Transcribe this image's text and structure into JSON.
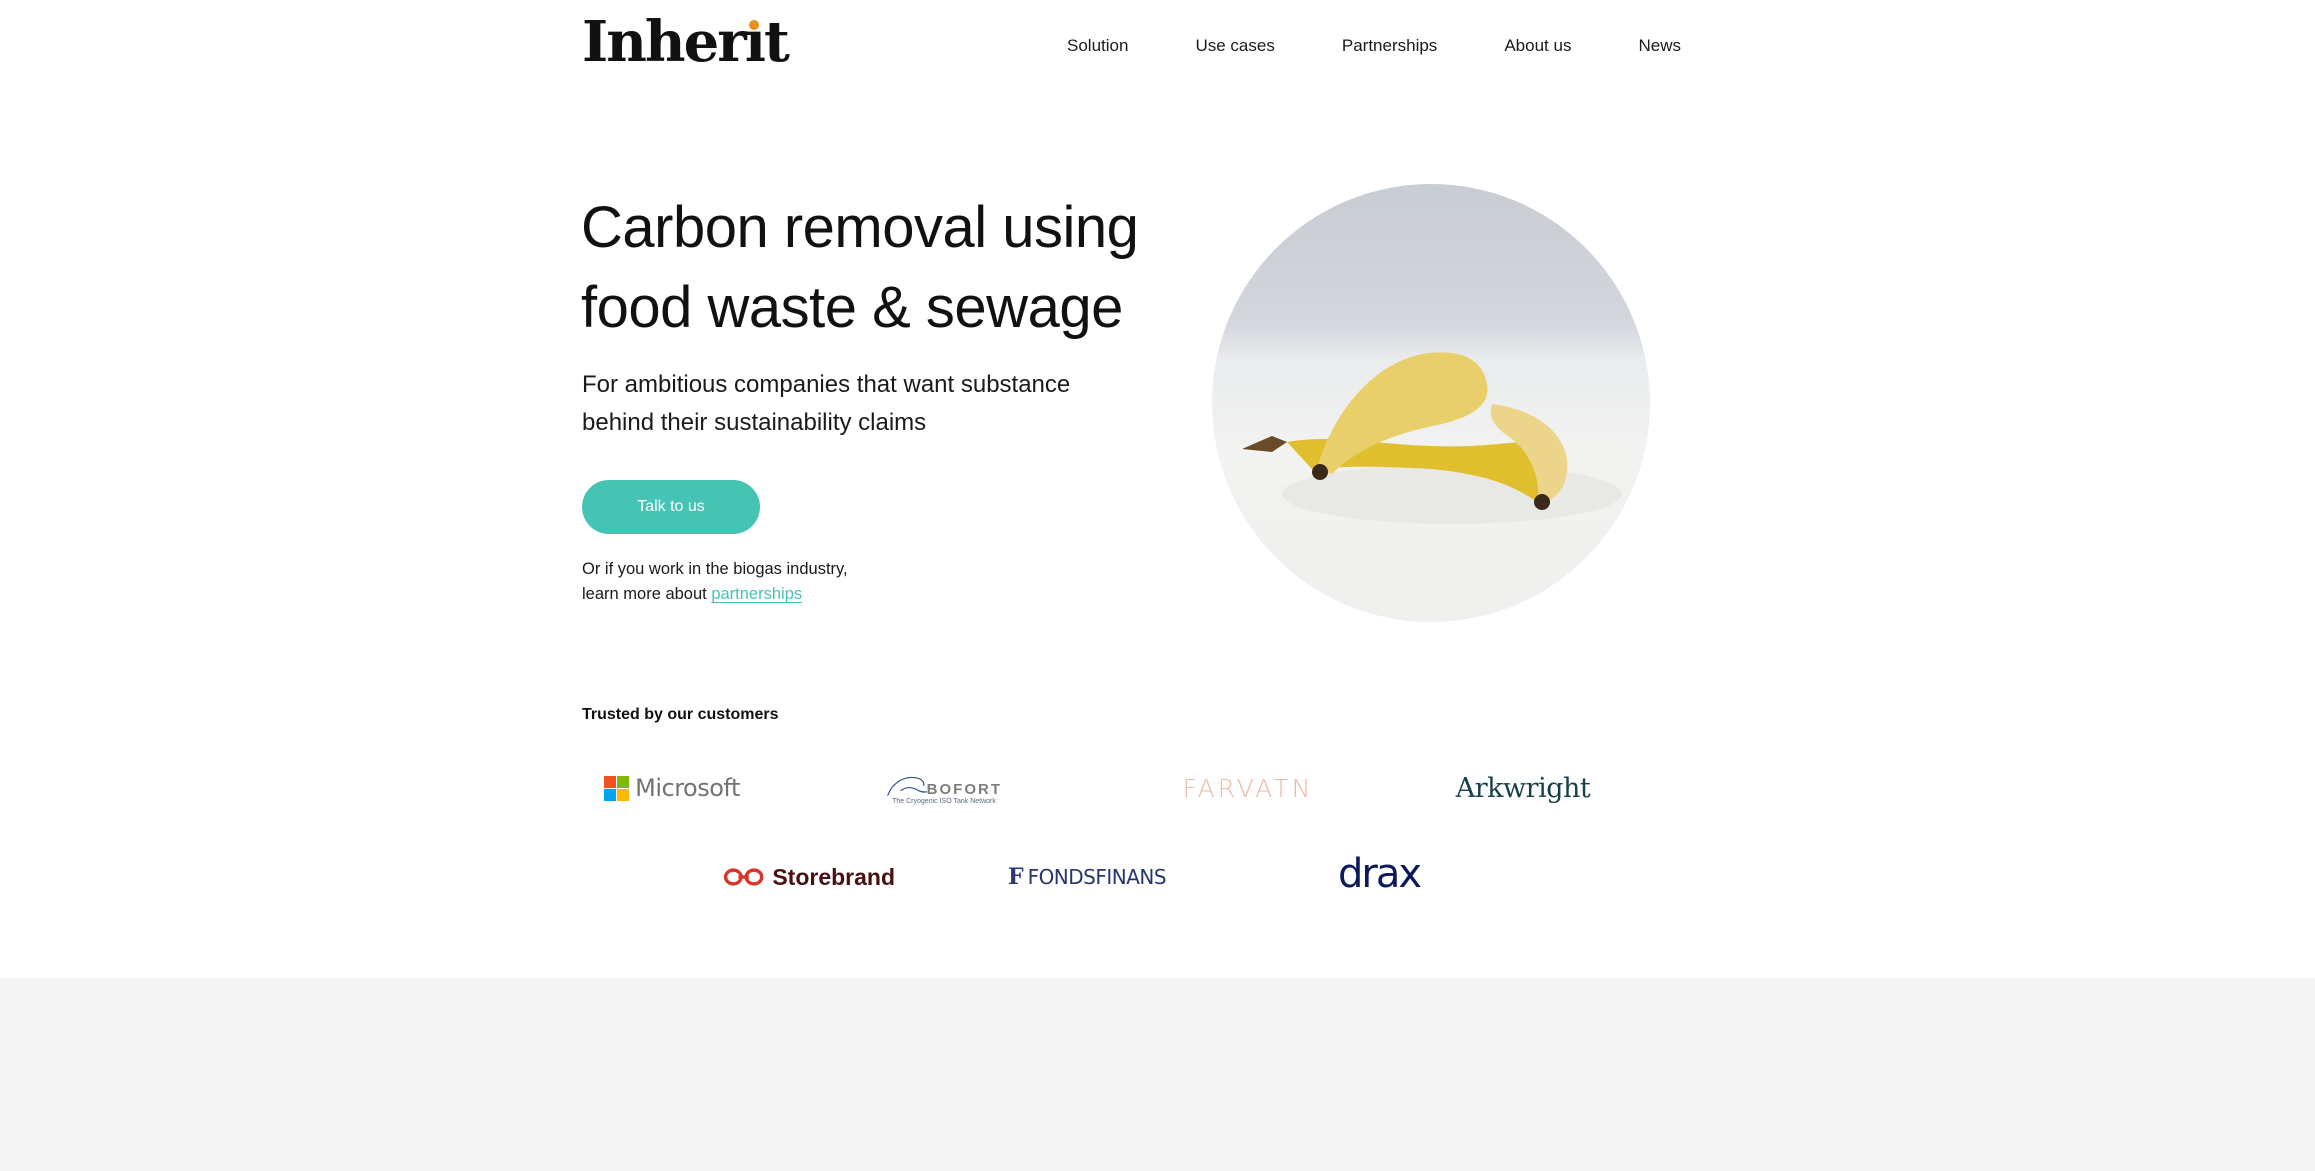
{
  "header": {
    "logo_text_pre": "Inher",
    "logo_text_i": "ı",
    "logo_text_post": "t",
    "logo_dot_color": "#E8901E",
    "nav": [
      {
        "label": "Solution"
      },
      {
        "label": "Use cases"
      },
      {
        "label": "Partnerships"
      },
      {
        "label": "About us"
      },
      {
        "label": "News"
      }
    ]
  },
  "hero": {
    "title_line1": "Carbon removal using",
    "title_line2": "food waste & sewage",
    "subtitle_line1": "For ambitious companies that want substance",
    "subtitle_line2": "behind their sustainability claims",
    "cta_label": "Talk to us",
    "note_line1": "Or if you work in the biogas industry,",
    "note_line2_prefix": "learn more about ",
    "note_link": "partnerships",
    "image_alt": "Banana peel on a white table",
    "accent_color": "#45C4B5"
  },
  "customers": {
    "heading": "Trusted by our customers",
    "logos": [
      {
        "name": "Microsoft"
      },
      {
        "name": "BOFORT",
        "tagline": "The Cryogenic ISO Tank Network"
      },
      {
        "name": "FARVATN"
      },
      {
        "name": "Arkwright"
      },
      {
        "name": "Storebrand"
      },
      {
        "name": "FONDSFINANS",
        "mark": "F"
      },
      {
        "name": "drax"
      }
    ]
  }
}
